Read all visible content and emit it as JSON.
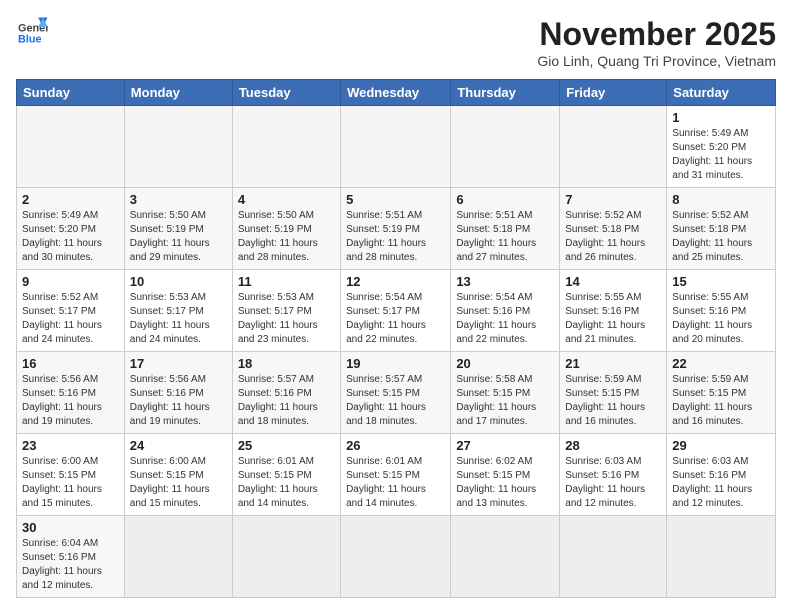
{
  "header": {
    "logo_general": "General",
    "logo_blue": "Blue",
    "month_year": "November 2025",
    "location": "Gio Linh, Quang Tri Province, Vietnam"
  },
  "days_of_week": [
    "Sunday",
    "Monday",
    "Tuesday",
    "Wednesday",
    "Thursday",
    "Friday",
    "Saturday"
  ],
  "weeks": [
    [
      {
        "day": "",
        "empty": true
      },
      {
        "day": "",
        "empty": true
      },
      {
        "day": "",
        "empty": true
      },
      {
        "day": "",
        "empty": true
      },
      {
        "day": "",
        "empty": true
      },
      {
        "day": "",
        "empty": true
      },
      {
        "day": "1",
        "sunrise": "5:49 AM",
        "sunset": "5:20 PM",
        "daylight": "11 hours and 31 minutes."
      }
    ],
    [
      {
        "day": "2",
        "sunrise": "5:49 AM",
        "sunset": "5:20 PM",
        "daylight": "11 hours and 30 minutes."
      },
      {
        "day": "3",
        "sunrise": "5:50 AM",
        "sunset": "5:19 PM",
        "daylight": "11 hours and 29 minutes."
      },
      {
        "day": "4",
        "sunrise": "5:50 AM",
        "sunset": "5:19 PM",
        "daylight": "11 hours and 28 minutes."
      },
      {
        "day": "5",
        "sunrise": "5:51 AM",
        "sunset": "5:19 PM",
        "daylight": "11 hours and 28 minutes."
      },
      {
        "day": "6",
        "sunrise": "5:51 AM",
        "sunset": "5:18 PM",
        "daylight": "11 hours and 27 minutes."
      },
      {
        "day": "7",
        "sunrise": "5:52 AM",
        "sunset": "5:18 PM",
        "daylight": "11 hours and 26 minutes."
      },
      {
        "day": "8",
        "sunrise": "5:52 AM",
        "sunset": "5:18 PM",
        "daylight": "11 hours and 25 minutes."
      }
    ],
    [
      {
        "day": "9",
        "sunrise": "5:52 AM",
        "sunset": "5:17 PM",
        "daylight": "11 hours and 24 minutes."
      },
      {
        "day": "10",
        "sunrise": "5:53 AM",
        "sunset": "5:17 PM",
        "daylight": "11 hours and 24 minutes."
      },
      {
        "day": "11",
        "sunrise": "5:53 AM",
        "sunset": "5:17 PM",
        "daylight": "11 hours and 23 minutes."
      },
      {
        "day": "12",
        "sunrise": "5:54 AM",
        "sunset": "5:17 PM",
        "daylight": "11 hours and 22 minutes."
      },
      {
        "day": "13",
        "sunrise": "5:54 AM",
        "sunset": "5:16 PM",
        "daylight": "11 hours and 22 minutes."
      },
      {
        "day": "14",
        "sunrise": "5:55 AM",
        "sunset": "5:16 PM",
        "daylight": "11 hours and 21 minutes."
      },
      {
        "day": "15",
        "sunrise": "5:55 AM",
        "sunset": "5:16 PM",
        "daylight": "11 hours and 20 minutes."
      }
    ],
    [
      {
        "day": "16",
        "sunrise": "5:56 AM",
        "sunset": "5:16 PM",
        "daylight": "11 hours and 19 minutes."
      },
      {
        "day": "17",
        "sunrise": "5:56 AM",
        "sunset": "5:16 PM",
        "daylight": "11 hours and 19 minutes."
      },
      {
        "day": "18",
        "sunrise": "5:57 AM",
        "sunset": "5:16 PM",
        "daylight": "11 hours and 18 minutes."
      },
      {
        "day": "19",
        "sunrise": "5:57 AM",
        "sunset": "5:15 PM",
        "daylight": "11 hours and 18 minutes."
      },
      {
        "day": "20",
        "sunrise": "5:58 AM",
        "sunset": "5:15 PM",
        "daylight": "11 hours and 17 minutes."
      },
      {
        "day": "21",
        "sunrise": "5:59 AM",
        "sunset": "5:15 PM",
        "daylight": "11 hours and 16 minutes."
      },
      {
        "day": "22",
        "sunrise": "5:59 AM",
        "sunset": "5:15 PM",
        "daylight": "11 hours and 16 minutes."
      }
    ],
    [
      {
        "day": "23",
        "sunrise": "6:00 AM",
        "sunset": "5:15 PM",
        "daylight": "11 hours and 15 minutes."
      },
      {
        "day": "24",
        "sunrise": "6:00 AM",
        "sunset": "5:15 PM",
        "daylight": "11 hours and 15 minutes."
      },
      {
        "day": "25",
        "sunrise": "6:01 AM",
        "sunset": "5:15 PM",
        "daylight": "11 hours and 14 minutes."
      },
      {
        "day": "26",
        "sunrise": "6:01 AM",
        "sunset": "5:15 PM",
        "daylight": "11 hours and 14 minutes."
      },
      {
        "day": "27",
        "sunrise": "6:02 AM",
        "sunset": "5:15 PM",
        "daylight": "11 hours and 13 minutes."
      },
      {
        "day": "28",
        "sunrise": "6:03 AM",
        "sunset": "5:16 PM",
        "daylight": "11 hours and 12 minutes."
      },
      {
        "day": "29",
        "sunrise": "6:03 AM",
        "sunset": "5:16 PM",
        "daylight": "11 hours and 12 minutes."
      }
    ],
    [
      {
        "day": "30",
        "sunrise": "6:04 AM",
        "sunset": "5:16 PM",
        "daylight": "11 hours and 12 minutes."
      },
      {
        "day": "",
        "empty": true
      },
      {
        "day": "",
        "empty": true
      },
      {
        "day": "",
        "empty": true
      },
      {
        "day": "",
        "empty": true
      },
      {
        "day": "",
        "empty": true
      },
      {
        "day": "",
        "empty": true
      }
    ]
  ],
  "labels": {
    "sunrise": "Sunrise:",
    "sunset": "Sunset:",
    "daylight": "Daylight:"
  }
}
